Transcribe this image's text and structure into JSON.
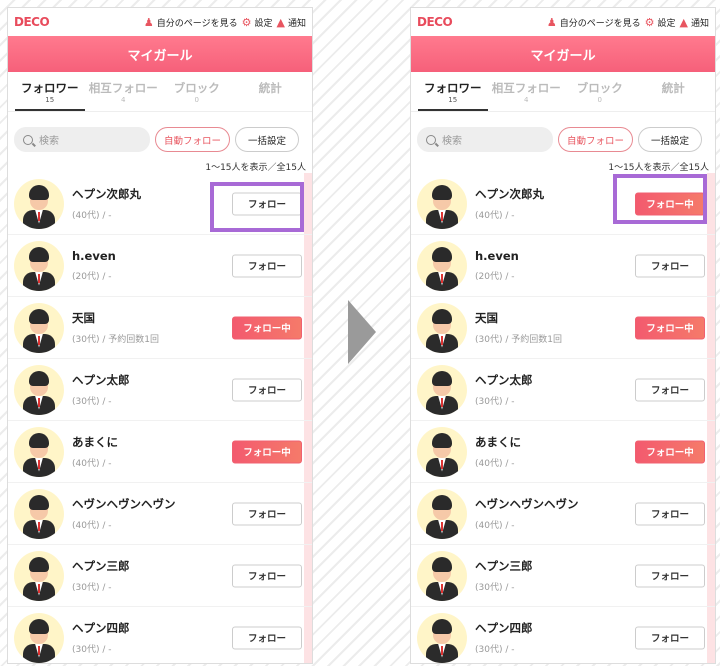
{
  "app": {
    "logo": "DECO",
    "top_links": {
      "mypage": "自分のページを見る",
      "settings": "設定",
      "notifications": "通知"
    },
    "header_title": "マイガール"
  },
  "tabs": [
    {
      "label": "フォロワー",
      "count": "15"
    },
    {
      "label": "相互フォロー",
      "count": "4"
    },
    {
      "label": "ブロック",
      "count": "0"
    },
    {
      "label": "統計",
      "count": ""
    }
  ],
  "search": {
    "placeholder": "検索"
  },
  "buttons": {
    "auto_follow": "自動フォロー",
    "bulk_settings": "一括設定",
    "follow": "フォロー",
    "following": "フォロー中"
  },
  "count_text": "1〜15人を表示／全15人",
  "colors": {
    "accent": "#f6607a",
    "following": "#f35a6e",
    "highlight": "#a86ad6"
  },
  "left_users": [
    {
      "name": "ヘプン次郎丸",
      "meta": "(40代) / -",
      "state": "フォロー"
    },
    {
      "name": "h.even",
      "meta": "(20代) / -",
      "state": "フォロー"
    },
    {
      "name": "天国",
      "meta": "(30代) / 予約回数1回",
      "state": "フォロー中"
    },
    {
      "name": "ヘプン太郎",
      "meta": "(30代) / -",
      "state": "フォロー"
    },
    {
      "name": "あまくに",
      "meta": "(40代) / -",
      "state": "フォロー中"
    },
    {
      "name": "ヘヴンヘヴンヘヴン",
      "meta": "(40代) / -",
      "state": "フォロー"
    },
    {
      "name": "ヘプン三郎",
      "meta": "(30代) / -",
      "state": "フォロー"
    },
    {
      "name": "ヘプン四郎",
      "meta": "(30代) / -",
      "state": "フォロー"
    }
  ],
  "right_users": [
    {
      "name": "ヘプン次郎丸",
      "meta": "(40代) / -",
      "state": "フォロー中"
    },
    {
      "name": "h.even",
      "meta": "(20代) / -",
      "state": "フォロー"
    },
    {
      "name": "天国",
      "meta": "(30代) / 予約回数1回",
      "state": "フォロー中"
    },
    {
      "name": "ヘプン太郎",
      "meta": "(30代) / -",
      "state": "フォロー"
    },
    {
      "name": "あまくに",
      "meta": "(40代) / -",
      "state": "フォロー中"
    },
    {
      "name": "ヘヴンヘヴンヘヴン",
      "meta": "(40代) / -",
      "state": "フォロー"
    },
    {
      "name": "ヘプン三郎",
      "meta": "(30代) / -",
      "state": "フォロー"
    },
    {
      "name": "ヘプン四郎",
      "meta": "(30代) / -",
      "state": "フォロー"
    }
  ]
}
